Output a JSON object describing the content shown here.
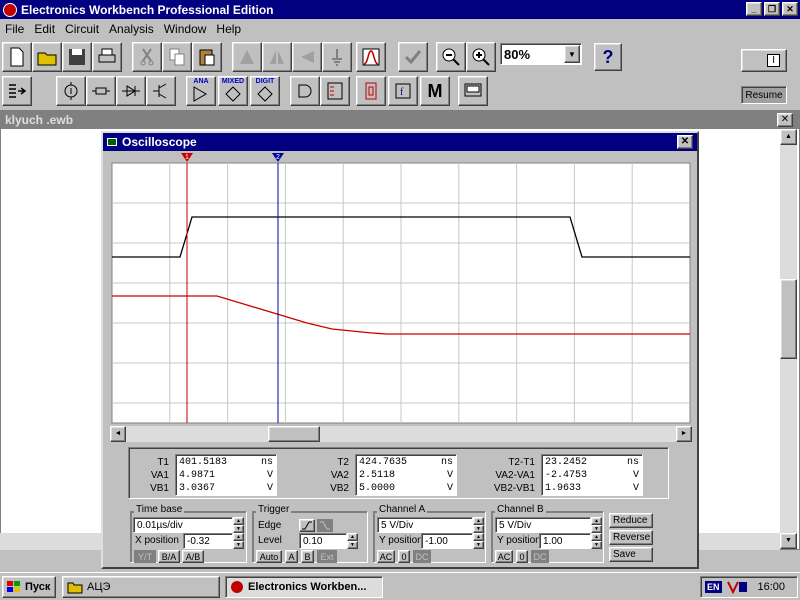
{
  "app": {
    "title": "Electronics Workbench Professional Edition"
  },
  "menu": [
    "File",
    "Edit",
    "Circuit",
    "Analysis",
    "Window",
    "Help"
  ],
  "toolbar": {
    "zoom_value": "80%",
    "help_label": "?",
    "resume_label": "Resume",
    "power_label": "I",
    "group_ana": "ANA",
    "group_mixed": "MIXED",
    "group_digit": "DIGIT",
    "meter_label": "M"
  },
  "document": {
    "title": "klyuch .ewb"
  },
  "oscilloscope": {
    "title": "Oscilloscope",
    "cursor1": "1",
    "cursor2": "2",
    "readouts": {
      "t1": {
        "labels": [
          "T1",
          "VA1",
          "VB1"
        ],
        "values": [
          "401.5183",
          "4.9871",
          "3.0367"
        ],
        "units": [
          "ns",
          "V",
          "V"
        ]
      },
      "t2": {
        "labels": [
          "T2",
          "VA2",
          "VB2"
        ],
        "values": [
          "424.7635",
          "2.5118",
          "5.0000"
        ],
        "units": [
          "ns",
          "V",
          "V"
        ]
      },
      "diff": {
        "labels": [
          "T2-T1",
          "VA2-VA1",
          "VB2-VB1"
        ],
        "values": [
          "23.2452",
          "-2.4753",
          "1.9633"
        ],
        "units": [
          "ns",
          "V",
          "V"
        ]
      }
    },
    "timebase": {
      "label": "Time base",
      "value": "0.01µs/div",
      "xpos_label": "X position",
      "xpos_value": "-0.32",
      "modes": [
        "Y/T",
        "B/A",
        "A/B"
      ]
    },
    "trigger": {
      "label": "Trigger",
      "edge_label": "Edge",
      "level_label": "Level",
      "level_value": "0.10",
      "modes": [
        "Auto",
        "A",
        "B",
        "Ext"
      ]
    },
    "channel_a": {
      "label": "Channel A",
      "scale": "5 V/Div",
      "ypos_label": "Y position",
      "ypos_value": "-1.00",
      "coupling": [
        "AC",
        "0",
        "DC"
      ]
    },
    "channel_b": {
      "label": "Channel B",
      "scale": "5 V/Div",
      "ypos_label": "Y position",
      "ypos_value": "1.00",
      "coupling": [
        "AC",
        "0",
        "DC"
      ]
    },
    "buttons": {
      "reduce": "Reduce",
      "reverse": "Reverse",
      "save": "Save"
    },
    "colors": {
      "trace_a": "#cc0000",
      "trace_b": "#000000",
      "cursor1": "#cc0000",
      "cursor2": "#0000aa"
    }
  },
  "taskbar": {
    "start": "Пуск",
    "items": [
      "АЦЭ",
      "Electronics Workben..."
    ],
    "lang": "EN",
    "time": "16:00"
  }
}
